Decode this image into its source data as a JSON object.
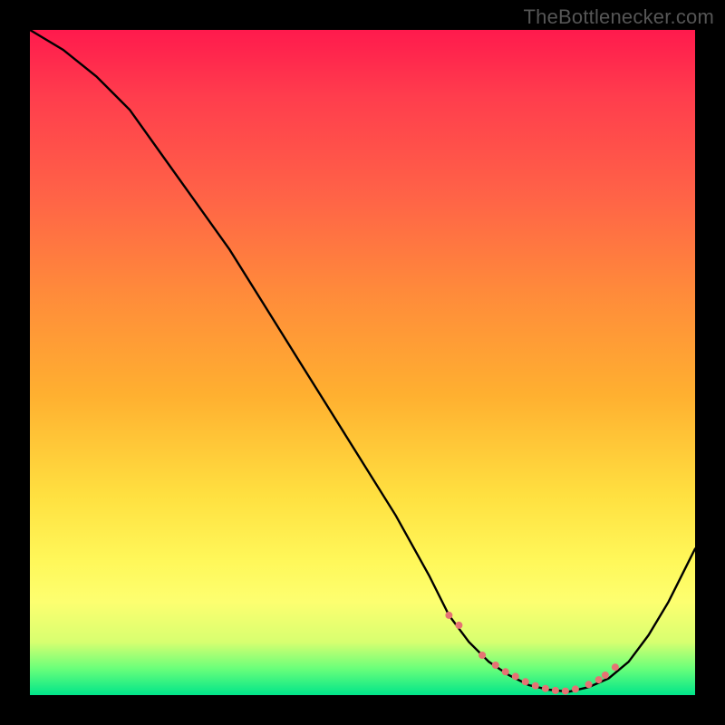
{
  "attribution": "TheBottlenecker.com",
  "colors": {
    "background_frame": "#000000",
    "gradient_top": "#ff1a4d",
    "gradient_bottom": "#00e58a",
    "curve": "#000000",
    "dots": "#e57373"
  },
  "chart_data": {
    "type": "line",
    "title": "",
    "xlabel": "",
    "ylabel": "",
    "xlim": [
      0,
      100
    ],
    "ylim": [
      0,
      100
    ],
    "grid": false,
    "legend": false,
    "series": [
      {
        "name": "bottleneck-curve",
        "x": [
          0,
          5,
          10,
          15,
          20,
          25,
          30,
          35,
          40,
          45,
          50,
          55,
          60,
          63,
          66,
          69,
          72,
          75,
          78,
          81,
          84,
          87,
          90,
          93,
          96,
          100
        ],
        "values": [
          100,
          97,
          93,
          88,
          81,
          74,
          67,
          59,
          51,
          43,
          35,
          27,
          18,
          12,
          8,
          5,
          3,
          1.5,
          0.8,
          0.5,
          1.2,
          2.5,
          5,
          9,
          14,
          22
        ]
      }
    ],
    "markers": {
      "name": "highlight-dots",
      "x": [
        63,
        64.5,
        68,
        70,
        71.5,
        73,
        74.5,
        76,
        77.5,
        79,
        80.5,
        82,
        84,
        85.5,
        86.5,
        88
      ],
      "values": [
        12,
        10.5,
        6,
        4.5,
        3.5,
        2.8,
        2.0,
        1.4,
        1.0,
        0.7,
        0.6,
        0.9,
        1.6,
        2.3,
        3.0,
        4.2
      ]
    }
  }
}
